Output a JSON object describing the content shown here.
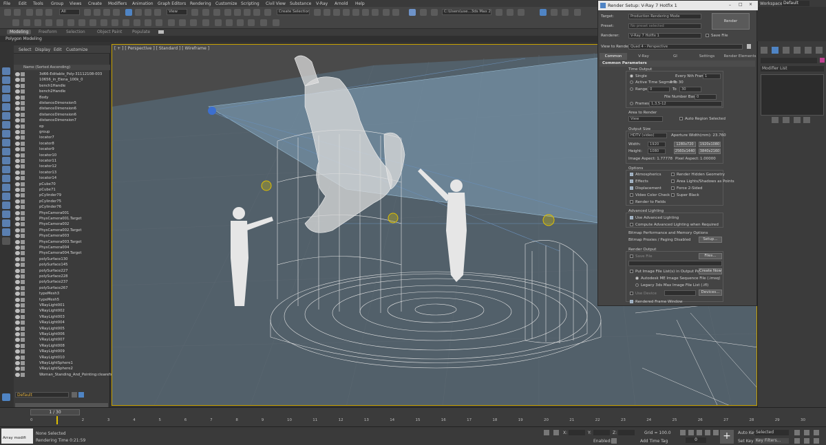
{
  "menu": [
    "File",
    "Edit",
    "Tools",
    "Group",
    "Views",
    "Create",
    "Modifiers",
    "Animation",
    "Graph Editors",
    "Rendering",
    "Customize",
    "Scripting",
    "Civil View",
    "Substance",
    "V-Ray",
    "Arnold",
    "Help"
  ],
  "workspaces": {
    "label": "Workspaces:",
    "value": "Default"
  },
  "toolbar": {
    "filter": "All",
    "view": "View",
    "create_selection_set": "Create Selection Se",
    "path": "C:\\Users\\use...3ds Max 2024"
  },
  "ribbon": {
    "tabs": [
      "Modeling",
      "Freeform",
      "Selection",
      "Object Paint",
      "Populate"
    ],
    "active": "Modeling",
    "sub": "Polygon Modeling"
  },
  "scene_explorer": {
    "tabs": [
      "Select",
      "Display",
      "Edit",
      "Customize"
    ],
    "column": "Name (Sorted Ascending)",
    "rows": [
      "3d66-Editable_Poly-31112108-003",
      "10656_in_Elena_100k_0",
      "bench1Handle",
      "bench2Handle",
      "Body",
      "distanceDimension5",
      "distanceDimension6",
      "distanceDimension6",
      "distanceDimension7",
      "ep",
      "group",
      "locator7",
      "locator8",
      "locator9",
      "locator10",
      "locator11",
      "locator12",
      "locator13",
      "locator14",
      "pCube70",
      "pCube71",
      "pCylinder79",
      "pCylinder75",
      "pCylinder76",
      "PhysCamera001",
      "PhysCamera001.Target",
      "PhysCamera002",
      "PhysCamera002.Target",
      "PhysCamera003",
      "PhysCamera003.Target",
      "PhysCamera004",
      "PhysCamera004.Target",
      "polySurface130",
      "polySurface145",
      "polySurface227",
      "polySurface228",
      "polySurface237",
      "polySurface267",
      "typeMesh3",
      "typeMesh5",
      "VRayLight001",
      "VRayLight002",
      "VRayLight003",
      "VRayLight004",
      "VRayLight005",
      "VRayLight006",
      "VRayLight007",
      "VRayLight008",
      "VRayLight009",
      "VRayLight010",
      "VRayLightSphere1",
      "VRayLightSphere2",
      "Woman_Standing_And_Pointing:clearefs_me"
    ],
    "layer": "Default"
  },
  "viewport": {
    "label": "[ + ] [ Perspective ] [ Standard ] [ Wireframe ]"
  },
  "render_setup": {
    "title": "Render Setup: V-Ray 7 Hotfix 1",
    "target_label": "Target:",
    "target": "Production Rendering Mode",
    "preset_label": "Preset:",
    "preset": "No preset selected",
    "renderer_label": "Renderer:",
    "renderer": "V-Ray 7 Hotfix 1",
    "save_file": "Save File",
    "render_btn": "Render",
    "view_label": "View to Render:",
    "view": "Quad 4 - Perspective",
    "tabs": [
      "Common",
      "V-Ray",
      "GI",
      "Settings",
      "Render Elements"
    ],
    "section": "Common Parameters",
    "time_output": "Time Output",
    "single": "Single",
    "every_nth": "Every Nth Frame:",
    "every_nth_val": "1",
    "active_segment": "Active Time Segment:",
    "active_segment_val": "0 To 30",
    "range": "Range:",
    "range_from": "0",
    "range_to_lbl": "To",
    "range_to": "30",
    "file_number_base": "File Number Base:",
    "file_number_base_val": "0",
    "frames": "Frames",
    "frames_val": "1,3,5-12",
    "area_to_render": "Area to Render",
    "area_val": "View",
    "auto_region": "Auto Region Selected",
    "output_size": "Output Size",
    "output_preset": "HDTV (video)",
    "aperture": "Aperture Width(mm): 23.760",
    "width_lbl": "Width:",
    "width_val": "1920",
    "height_lbl": "Height:",
    "height_val": "1080",
    "res": [
      "1280x720",
      "1920x1080",
      "2560x1440",
      "3840x2160"
    ],
    "image_aspect": "Image Aspect: 1.77778",
    "pixel_aspect": "Pixel Aspect:",
    "pixel_aspect_val": "1.00000",
    "options": "Options",
    "opts_left": [
      "Atmospherics",
      "Effects",
      "Displacement",
      "Video Color Check",
      "Render to Fields"
    ],
    "opts_right": [
      "Render Hidden Geometry",
      "Area Lights/Shadows as Points",
      "Force 2-Sided",
      "Super Black"
    ],
    "adv_lighting": "Advanced Lighting",
    "use_adv": "Use Advanced Lighting",
    "compute_adv": "Compute Advanced Lighting when Required",
    "bitmap_perf": "Bitmap Performance and Memory Options",
    "bitmap_proxies": "Bitmap Proxies / Paging Disabled",
    "setup_btn": "Setup...",
    "render_output": "Render Output",
    "save_file2": "Save File",
    "files_btn": "Files...",
    "put_image": "Put Image File List(s) in Output Path(s)",
    "create_now": "Create Now",
    "autodesk_me": "Autodesk ME Image Sequence File (.imsq)",
    "legacy": "Legacy 3ds Max Image File List (.ifl)",
    "use_device": "Use Device",
    "devices_btn": "Devices...",
    "rendered_frame_window": "Rendered Frame Window"
  },
  "cmd_panel": {
    "modifier_list": "Modifier List"
  },
  "timeline": {
    "frame": "1 / 30",
    "ticks": [
      "0",
      "1",
      "2",
      "3",
      "4",
      "5",
      "6",
      "7",
      "8",
      "9",
      "10",
      "11",
      "12",
      "13",
      "14",
      "15",
      "16",
      "17",
      "18",
      "19",
      "20",
      "21",
      "22",
      "23",
      "24",
      "25",
      "26",
      "27",
      "28",
      "29",
      "30"
    ]
  },
  "status": {
    "script": "Array modifi",
    "none_selected": "None Selected",
    "rendering_time": "Rendering Time  0:21:59",
    "x": "X:",
    "y": "Y:",
    "z": "Z:",
    "grid": "Grid = 100.0",
    "enabled": "Enabled:",
    "add_time_tag": "Add Time Tag",
    "auto_key": "Auto Key",
    "selected": "Selected",
    "set_key": "Set Key",
    "key_filters": "Key Filters...",
    "frame_val": "0"
  },
  "colors": {
    "accent": "#4f84c4",
    "viewport_border": "#c9a200",
    "wire": "#e6e6e6"
  }
}
